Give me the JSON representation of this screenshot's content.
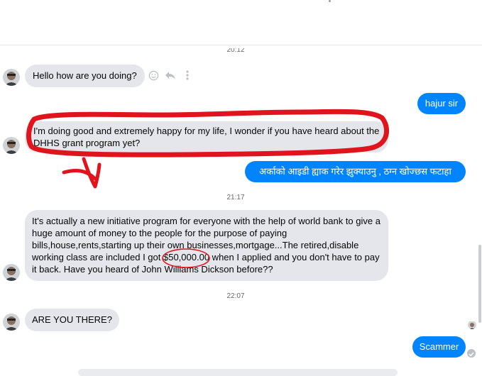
{
  "timestamps": {
    "top_clipped": "20:12",
    "t1": "21:17",
    "t2": "22:07"
  },
  "messages": {
    "m1": "Hello how are you doing?",
    "m2": "hajur sir",
    "m3": "I'm doing good and extremely happy for my life, I wonder if you have heard about the DHHS grant program yet?",
    "m4": "अर्काको आइडी ह्याक गरेर झुक्याउनु , ठग्न खोज्छस फटाहा",
    "m5_before": "It's actually a new initiative program for everyone with the help of world bank to give a huge amount of money to the people for the purpose of paying bills,house,rents,starting up their own businesses,mortgage...The retired,disable working class are included I got ",
    "m5_amount": "$50,000.00",
    "m5_after": " when I applied and you don't have to pay it back.  Have you heard of John Williams Dickson before??",
    "m6": "ARE YOU THERE?",
    "m7": "Scammer"
  },
  "icons": {
    "react": "smiley-icon",
    "reply": "reply-arrow-icon",
    "more": "vertical-dots-icon"
  },
  "colors": {
    "outgoing_bubble": "#0084ff",
    "incoming_bubble": "#e4e6eb",
    "annotation": "#e0141c"
  }
}
